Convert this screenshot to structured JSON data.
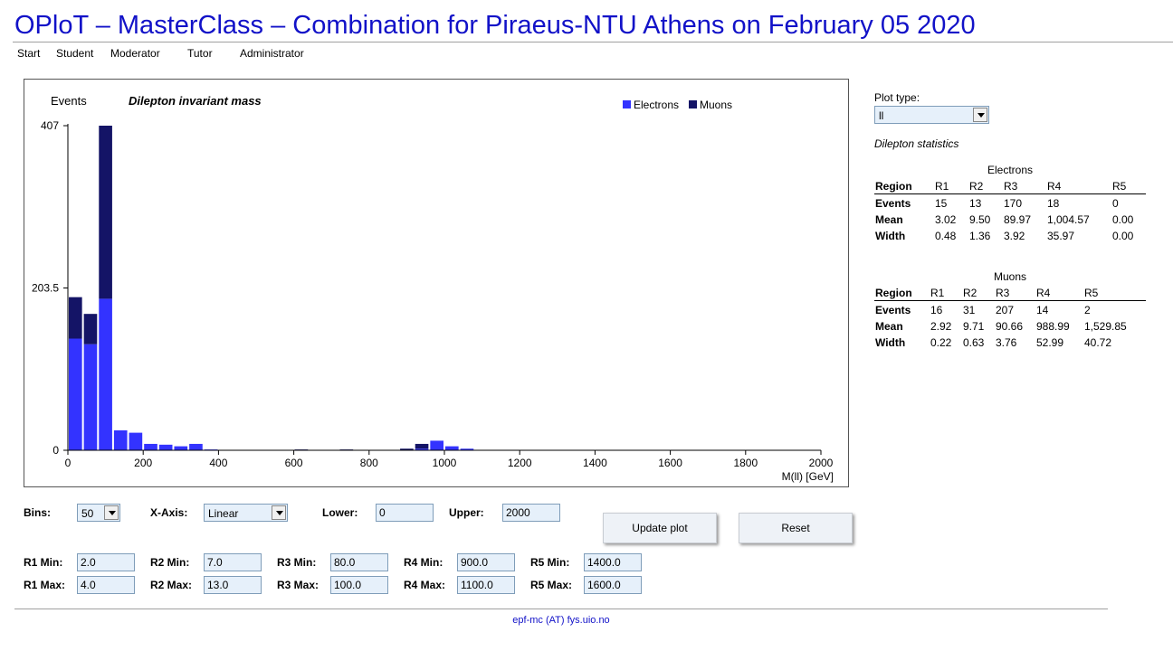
{
  "page": {
    "title": "OPloT – MasterClass – Combination for Piraeus-NTU Athens on February 05 2020"
  },
  "nav": [
    "Start",
    "Student",
    "Moderator",
    "Tutor",
    "Administrator"
  ],
  "plot": {
    "plot_type_label": "Plot type:",
    "plot_type_value": "ll",
    "stats_title": "Dilepton statistics"
  },
  "colors": {
    "electrons": "#3333ff",
    "muons": "#141466",
    "title": "#1212c8"
  },
  "chart_data": {
    "type": "bar",
    "stacked": true,
    "title": "Dilepton invariant mass",
    "ylabel": "Events",
    "xlabel": "M(ll) [GeV]",
    "x_ticks": [
      "0",
      "200",
      "400",
      "600",
      "800",
      "1000",
      "1200",
      "1400",
      "1600",
      "1800",
      "2000"
    ],
    "y_ticks": [
      "0",
      "203.5",
      "407"
    ],
    "xlim": [
      0,
      2000
    ],
    "ylim": [
      0,
      407
    ],
    "legend": {
      "position": "top-right",
      "entries": [
        "Electrons",
        "Muons"
      ]
    },
    "bin_width": 40,
    "bin_starts": [
      0,
      40,
      80,
      120,
      160,
      200,
      240,
      280,
      320,
      360,
      600,
      720,
      880,
      920,
      960,
      1000,
      1040
    ],
    "series": [
      {
        "name": "Electrons",
        "values": [
          140,
          133,
          190,
          25,
          22,
          8,
          7,
          5,
          8,
          1,
          0,
          0,
          0,
          2,
          12,
          5,
          2
        ]
      },
      {
        "name": "Muons",
        "values": [
          52,
          38,
          217,
          0,
          0,
          0,
          0,
          0,
          0,
          0,
          1,
          1,
          2,
          6,
          0,
          0,
          0
        ]
      }
    ]
  },
  "electrons_stats": {
    "caption": "Electrons",
    "headers": [
      "Region",
      "R1",
      "R2",
      "R3",
      "R4",
      "R5"
    ],
    "rows": [
      [
        "Events",
        "15",
        "13",
        "170",
        "18",
        "0"
      ],
      [
        "Mean",
        "3.02",
        "9.50",
        "89.97",
        "1,004.57",
        "0.00"
      ],
      [
        "Width",
        "0.48",
        "1.36",
        "3.92",
        "35.97",
        "0.00"
      ]
    ]
  },
  "muons_stats": {
    "caption": "Muons",
    "headers": [
      "Region",
      "R1",
      "R2",
      "R3",
      "R4",
      "R5"
    ],
    "rows": [
      [
        "Events",
        "16",
        "31",
        "207",
        "14",
        "2"
      ],
      [
        "Mean",
        "2.92",
        "9.71",
        "90.66",
        "988.99",
        "1,529.85"
      ],
      [
        "Width",
        "0.22",
        "0.63",
        "3.76",
        "52.99",
        "40.72"
      ]
    ]
  },
  "controls": {
    "bins_label": "Bins:",
    "bins_value": "50",
    "xaxis_label": "X-Axis:",
    "xaxis_value": "Linear",
    "lower_label": "Lower:",
    "lower_value": "0",
    "upper_label": "Upper:",
    "upper_value": "2000",
    "update_button": "Update plot",
    "reset_button": "Reset"
  },
  "regions": {
    "r1_min_label": "R1 Min:",
    "r1_min": "2.0",
    "r1_max_label": "R1 Max:",
    "r1_max": "4.0",
    "r2_min_label": "R2 Min:",
    "r2_min": "7.0",
    "r2_max_label": "R2 Max:",
    "r2_max": "13.0",
    "r3_min_label": "R3 Min:",
    "r3_min": "80.0",
    "r3_max_label": "R3 Max:",
    "r3_max": "100.0",
    "r4_min_label": "R4 Min:",
    "r4_min": "900.0",
    "r4_max_label": "R4 Max:",
    "r4_max": "1100.0",
    "r5_min_label": "R5 Min:",
    "r5_min": "1400.0",
    "r5_max_label": "R5 Max:",
    "r5_max": "1600.0"
  },
  "footer": "epf-mc (AT) fys.uio.no"
}
